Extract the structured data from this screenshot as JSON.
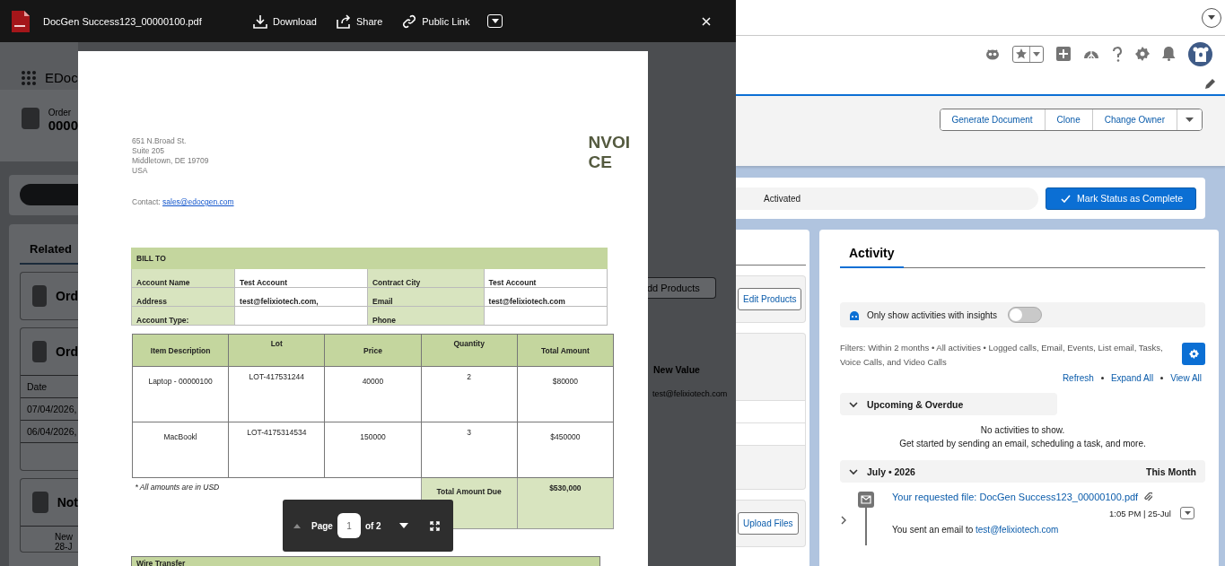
{
  "viewer": {
    "file_name": "DocGen Success123_00000100.pdf",
    "actions": [
      {
        "kind": "download",
        "label": "Download"
      },
      {
        "kind": "share",
        "label": "Share"
      },
      {
        "kind": "link",
        "label": "Public Link"
      }
    ]
  },
  "invoice": {
    "address": [
      "651 N.Broad St.",
      "Suite 205",
      "Middletown, DE 19709",
      "USA"
    ],
    "contact_label": "Contact:",
    "contact_email": "sales@edocgen.com",
    "title": [
      "NVOI",
      "CE"
    ],
    "bill_to": {
      "heading": "BILL TO",
      "rows": [
        {
          "cells": [
            {
              "label": "Account Name",
              "value": "Test Account"
            },
            {
              "label": "Contract City",
              "value": "Test Account"
            }
          ]
        },
        {
          "cells": [
            {
              "label": "Address",
              "value": "test@felixiotech.com,"
            },
            {
              "label": "Email",
              "value": "test@felixiotech.com"
            }
          ]
        },
        {
          "cells": [
            {
              "label": "Account Type:"
            },
            {
              "label": "Phone"
            }
          ]
        }
      ]
    },
    "items": {
      "columns": [
        "Item Description",
        "Lot",
        "Price",
        "Quantity",
        "Total Amount"
      ],
      "rows": [
        [
          "Laptop - 00000100",
          "LOT-417531244",
          "40000",
          "2",
          "$80000"
        ],
        [
          "MacBookl",
          "LOT-4175314534",
          "150000",
          "3",
          "$450000"
        ]
      ]
    },
    "note": "* All amounts are in USD",
    "total": {
      "label": "Total Amount Due",
      "value": "$530,000"
    },
    "wire_heading": "Wire Transfer"
  },
  "pager": {
    "label": "Page",
    "value": "1",
    "total": "of 2"
  },
  "background_left": {
    "app_name": "EDoc",
    "record_label": "Order",
    "record_number": "0000",
    "tabs": [
      {
        "label": "Related",
        "selected": true
      }
    ],
    "cards": [
      "Ord",
      "Ord"
    ],
    "table_header": "Date",
    "table_rows": [
      "07/04/2026,",
      "06/04/2026,"
    ],
    "notes_title": "Not",
    "note_lines": [
      "New",
      "28-J"
    ]
  },
  "background_right": {
    "add_products": "dd Products",
    "column": "New Value",
    "cell": "test@felixiotech.com"
  },
  "record_actions": [
    "Generate Document",
    "Clone",
    "Change Owner"
  ],
  "path": {
    "stage": "Activated",
    "complete_button": "Mark Status as Complete"
  },
  "related_fragment": {
    "edit_button": "Edit Products",
    "upload_button": "Upload Files"
  },
  "activity": {
    "tabs": [
      {
        "label": "Activity",
        "selected": true
      }
    ],
    "insights": {
      "label": "Only show activities with insights",
      "on": false
    },
    "filters": "Filters: Within 2 months • All activities • Logged calls, Email, Events, List email, Tasks, Voice Calls, and Video Calls",
    "links": [
      "Refresh",
      "Expand All",
      "View All"
    ],
    "sections": [
      {
        "title": "Upcoming & Overdue",
        "expanded": true,
        "empty_lines": [
          "No activities to show.",
          "Get started by sending an email, scheduling a task, and more."
        ]
      },
      {
        "title": "July • 2026",
        "expanded": true,
        "note": "This Month",
        "items": [
          {
            "kind": "email",
            "expanded": false,
            "title": "Your requested file: DocGen Success123_00000100.pdf",
            "time": "1:05 PM | 25-Jul",
            "summary": "You sent an email to",
            "summary_link": "test@felixiotech.com"
          }
        ]
      }
    ]
  }
}
